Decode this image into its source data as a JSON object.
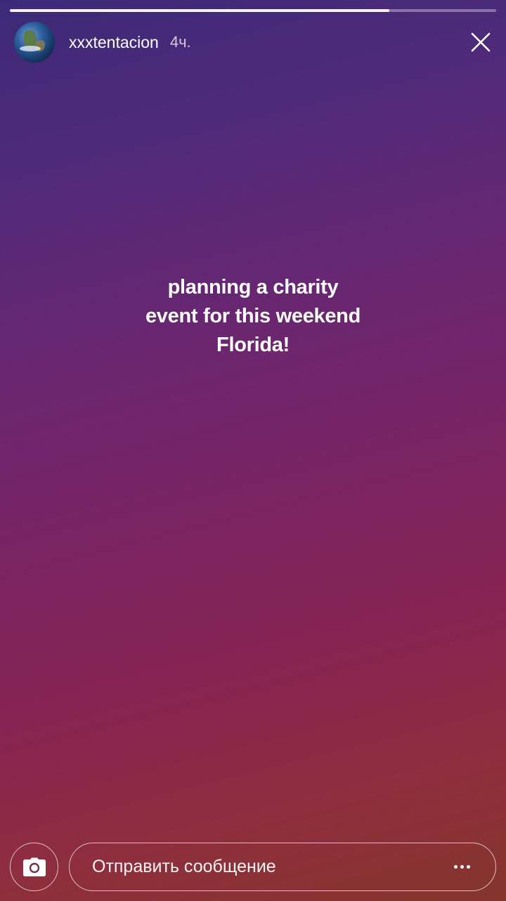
{
  "story": {
    "progress": 0.78,
    "username": "xxxtentacion",
    "time_ago": "4ч.",
    "lines": [
      "planning a charity",
      "event for this weekend",
      "Florida!"
    ]
  },
  "icons": {
    "avatar": "earth-avatar",
    "close": "close-icon",
    "camera": "camera-icon",
    "more": "more-dots-icon"
  },
  "reply": {
    "placeholder": "Отправить сообщение"
  },
  "colors": {
    "gradient_top": "#3c2a78",
    "gradient_middle": "#7d2360",
    "gradient_bottom": "#85352c",
    "text": "#ffffff"
  }
}
